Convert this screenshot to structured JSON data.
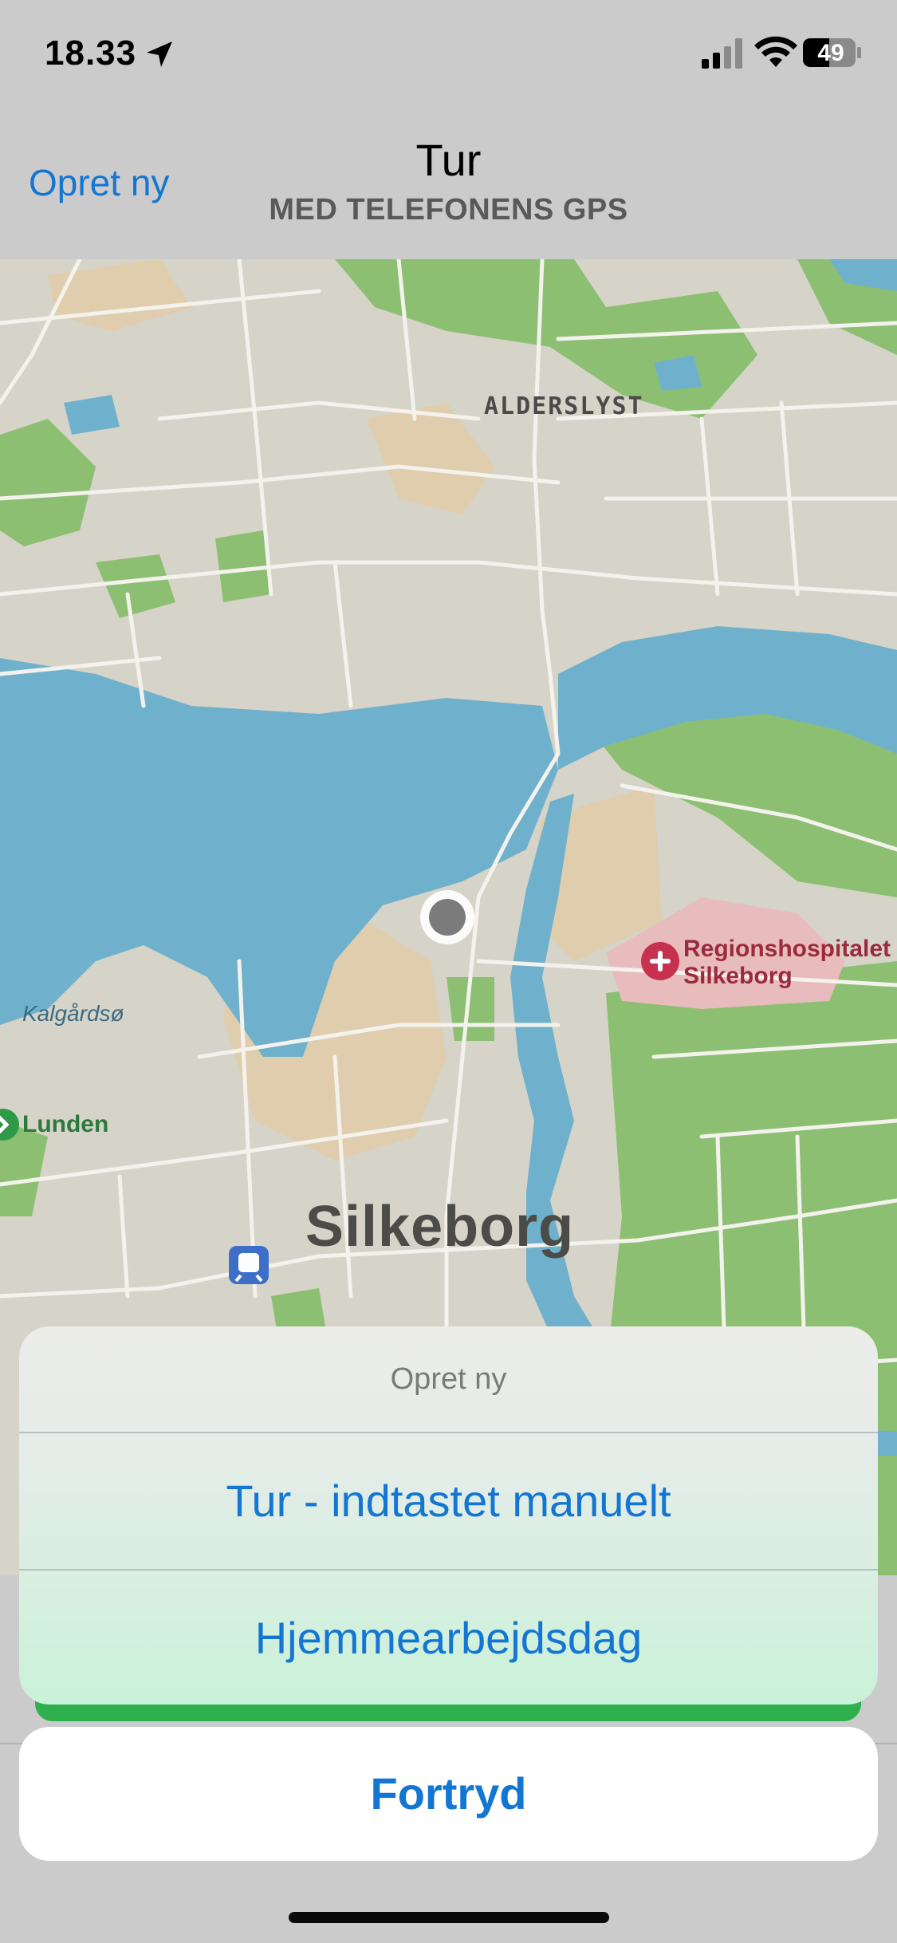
{
  "status_bar": {
    "time": "18.33",
    "battery": "49",
    "icons": [
      "location-arrow-icon",
      "signal-icon",
      "wifi-icon",
      "battery-icon"
    ]
  },
  "nav": {
    "left_button": "Opret ny",
    "title": "Tur",
    "subtitle": "MED TELEFONENS GPS"
  },
  "map": {
    "labels": {
      "alderslyst": "ALDERSLYST",
      "kalgaardsoe": "Kalgårdsø",
      "lunden": "Lunden",
      "hospital_line1": "Regionshospitalet",
      "hospital_line2": "Silkeborg",
      "city": "Silkeborg"
    },
    "colors": {
      "land": "#d6d3c8",
      "water": "#6fb1cc",
      "park": "#8cbf72",
      "roads": "#f4f2ec",
      "hospital": "#e8bcbc"
    }
  },
  "action_sheet": {
    "title": "Opret ny",
    "options": [
      "Tur - indtastet manuelt",
      "Hjemmearbejdsdag"
    ],
    "cancel": "Fortryd"
  },
  "colors": {
    "accent": "#1476d3",
    "background": "#cbcbcb"
  }
}
